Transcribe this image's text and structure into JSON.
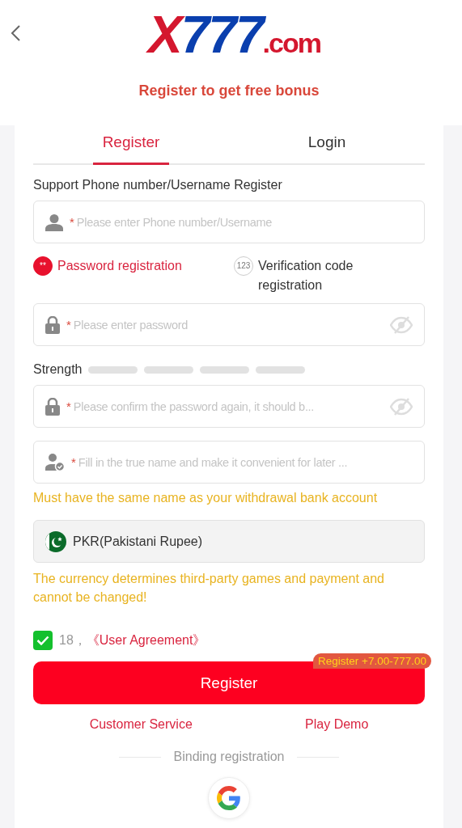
{
  "header": {
    "logo": [
      {
        "text": "X",
        "color": "#d4172e"
      },
      {
        "text": "777",
        "color": "#0a3fae"
      },
      {
        "text": ".com",
        "color": "#d4172e"
      }
    ]
  },
  "promo": "Register to get free bonus",
  "tabs": [
    {
      "label": "Register",
      "selected": true
    },
    {
      "label": "Login",
      "selected": false
    }
  ],
  "section_label": "Support Phone number/Username Register",
  "account_field": {
    "kind": "user",
    "marker": "*",
    "placeholder": "Please enter Phone number/Username"
  },
  "methods": [
    {
      "badge": "**",
      "label": "Password registration",
      "selected": true
    },
    {
      "badge": "123",
      "label": "Verification code registration",
      "selected": false
    }
  ],
  "password_field": {
    "kind": "lock",
    "marker": "*",
    "placeholder": "Please enter password",
    "eye": true
  },
  "strength": {
    "label": "Strength"
  },
  "confirm_field": {
    "kind": "lock",
    "marker": "*",
    "placeholder": "Please confirm the password again, it should b...",
    "eye": true
  },
  "name_field": {
    "kind": "user-check",
    "marker": "*",
    "placeholder": "Fill in the true name and make it convenient for later ..."
  },
  "name_hint": "Must have the same name as your withdrawal bank account",
  "currency": {
    "value": "PKR(Pakistani Rupee)"
  },
  "currency_hint": "The currency determines third-party games and payment and cannot be changed!",
  "agreement": {
    "checked": true,
    "prefix": "18，",
    "link": "《User Agreement》"
  },
  "register_button": {
    "label": "Register",
    "badge": "Register +7.00-777.00"
  },
  "links": [
    "Customer Service",
    "Play Demo"
  ],
  "binding": {
    "label": "Binding registration"
  }
}
